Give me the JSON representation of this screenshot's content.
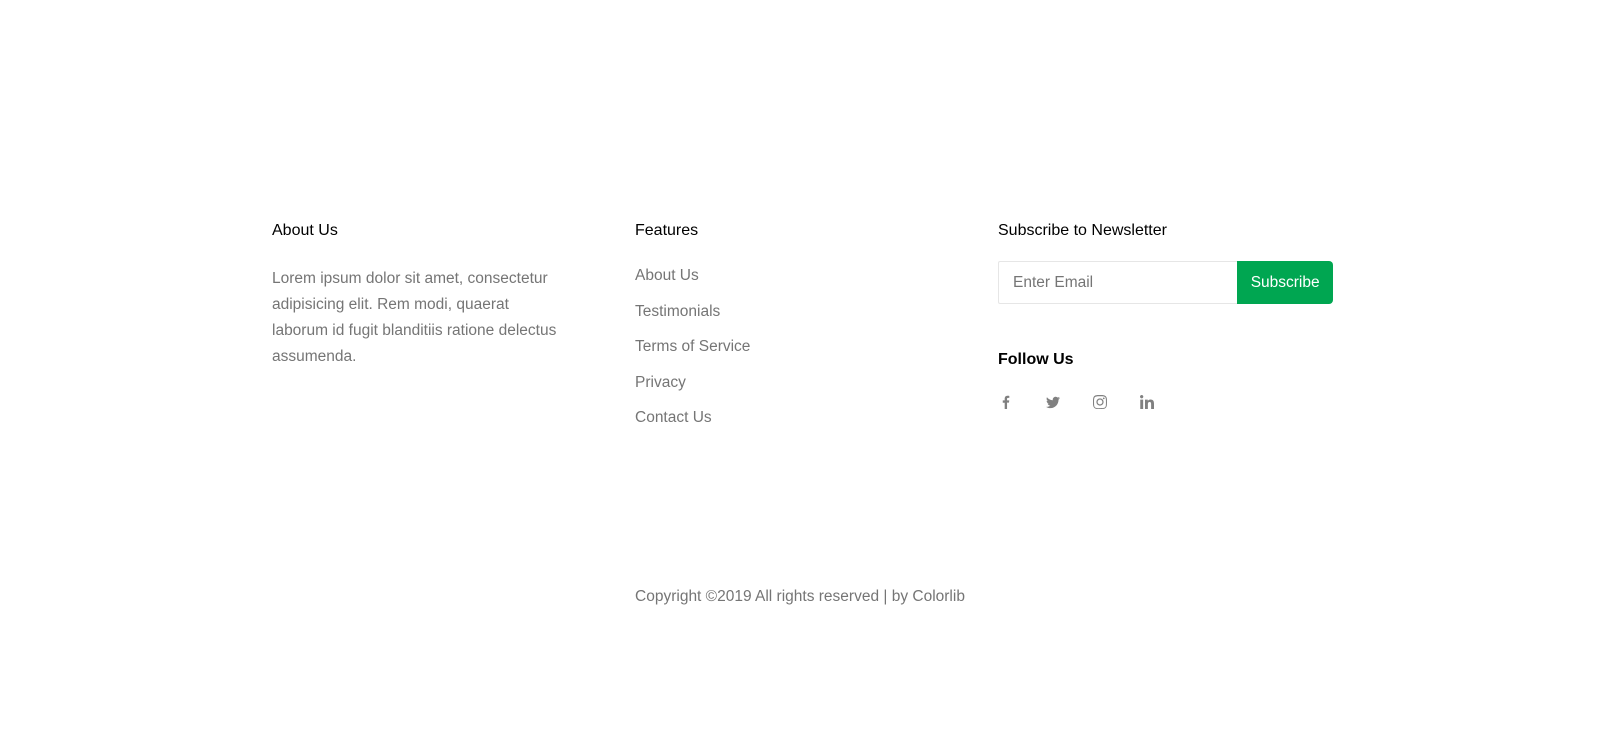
{
  "about": {
    "heading": "About Us",
    "text": "Lorem ipsum dolor sit amet, consectetur adipisicing elit. Rem modi, quaerat laborum id fugit blanditiis ratione delectus assumenda."
  },
  "features": {
    "heading": "Features",
    "items": [
      "About Us",
      "Testimonials",
      "Terms of Service",
      "Privacy",
      "Contact Us"
    ]
  },
  "newsletter": {
    "heading": "Subscribe to Newsletter",
    "placeholder": "Enter Email",
    "button_label": "Subscribe",
    "accent_color": "#00a651"
  },
  "follow": {
    "heading": "Follow Us",
    "icons": [
      "facebook-icon",
      "twitter-icon",
      "instagram-icon",
      "linkedin-icon"
    ]
  },
  "copyright": {
    "text": "Copyright ©2019 All rights reserved | by ",
    "brand": "Colorlib"
  }
}
